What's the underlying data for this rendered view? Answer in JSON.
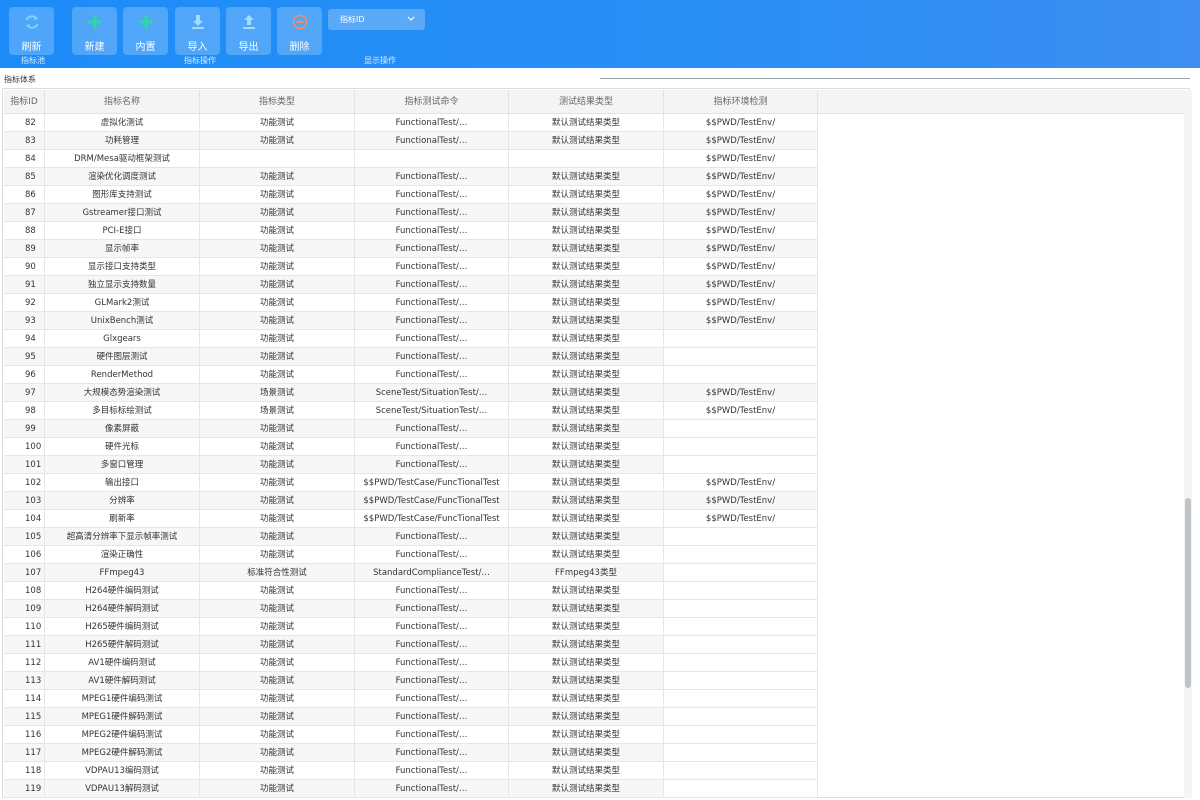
{
  "toolbar": {
    "refresh_label": "刷新",
    "new_label": "新建",
    "builtin_label": "内置",
    "import_label": "导入",
    "export_label": "导出",
    "delete_label": "删除",
    "group_pool": "指标池",
    "group_ops": "指标操作",
    "group_display": "显示操作",
    "dropdown_value": "指标ID"
  },
  "panel": {
    "title": "指标体系"
  },
  "table": {
    "columns": [
      "指标ID",
      "指标名称",
      "指标类型",
      "指标测试命令",
      "测试结果类型",
      "指标环境检测"
    ],
    "rows": [
      [
        "82",
        "虚拟化测试",
        "功能测试",
        "FunctionalTest/…",
        "默认测试结果类型",
        "$$PWD/TestEnv/"
      ],
      [
        "83",
        "功耗管理",
        "功能测试",
        "FunctionalTest/…",
        "默认测试结果类型",
        "$$PWD/TestEnv/"
      ],
      [
        "84",
        "DRM/Mesa驱动框架测试",
        "",
        "",
        "",
        "$$PWD/TestEnv/"
      ],
      [
        "85",
        "渲染优化调度测试",
        "功能测试",
        "FunctionalTest/…",
        "默认测试结果类型",
        "$$PWD/TestEnv/"
      ],
      [
        "86",
        "图形库支持测试",
        "功能测试",
        "FunctionalTest/…",
        "默认测试结果类型",
        "$$PWD/TestEnv/"
      ],
      [
        "87",
        "Gstreamer接口测试",
        "功能测试",
        "FunctionalTest/…",
        "默认测试结果类型",
        "$$PWD/TestEnv/"
      ],
      [
        "88",
        "PCI-E接口",
        "功能测试",
        "FunctionalTest/…",
        "默认测试结果类型",
        "$$PWD/TestEnv/"
      ],
      [
        "89",
        "显示帧率",
        "功能测试",
        "FunctionalTest/…",
        "默认测试结果类型",
        "$$PWD/TestEnv/"
      ],
      [
        "90",
        "显示接口支持类型",
        "功能测试",
        "FunctionalTest/…",
        "默认测试结果类型",
        "$$PWD/TestEnv/"
      ],
      [
        "91",
        "独立显示支持数量",
        "功能测试",
        "FunctionalTest/…",
        "默认测试结果类型",
        "$$PWD/TestEnv/"
      ],
      [
        "92",
        "GLMark2测试",
        "功能测试",
        "FunctionalTest/…",
        "默认测试结果类型",
        "$$PWD/TestEnv/"
      ],
      [
        "93",
        "UnixBench测试",
        "功能测试",
        "FunctionalTest/…",
        "默认测试结果类型",
        "$$PWD/TestEnv/"
      ],
      [
        "94",
        "Glxgears",
        "功能测试",
        "FunctionalTest/…",
        "默认测试结果类型",
        ""
      ],
      [
        "95",
        "硬件图层测试",
        "功能测试",
        "FunctionalTest/…",
        "默认测试结果类型",
        ""
      ],
      [
        "96",
        "RenderMethod",
        "功能测试",
        "FunctionalTest/…",
        "默认测试结果类型",
        ""
      ],
      [
        "97",
        "大规模态势渲染测试",
        "场景测试",
        "SceneTest/SituationTest/…",
        "默认测试结果类型",
        "$$PWD/TestEnv/"
      ],
      [
        "98",
        "多目标标绘测试",
        "场景测试",
        "SceneTest/SituationTest/…",
        "默认测试结果类型",
        "$$PWD/TestEnv/"
      ],
      [
        "99",
        "像素屏蔽",
        "功能测试",
        "FunctionalTest/…",
        "默认测试结果类型",
        ""
      ],
      [
        "100",
        "硬件光标",
        "功能测试",
        "FunctionalTest/…",
        "默认测试结果类型",
        ""
      ],
      [
        "101",
        "多窗口管理",
        "功能测试",
        "FunctionalTest/…",
        "默认测试结果类型",
        ""
      ],
      [
        "102",
        "输出接口",
        "功能测试",
        "$$PWD/TestCase/FuncTionalTest",
        "默认测试结果类型",
        "$$PWD/TestEnv/"
      ],
      [
        "103",
        "分辨率",
        "功能测试",
        "$$PWD/TestCase/FuncTionalTest",
        "默认测试结果类型",
        "$$PWD/TestEnv/"
      ],
      [
        "104",
        "刷新率",
        "功能测试",
        "$$PWD/TestCase/FuncTionalTest",
        "默认测试结果类型",
        "$$PWD/TestEnv/"
      ],
      [
        "105",
        "超高清分辨率下显示帧率测试",
        "功能测试",
        "FunctionalTest/…",
        "默认测试结果类型",
        ""
      ],
      [
        "106",
        "渲染正确性",
        "功能测试",
        "FunctionalTest/…",
        "默认测试结果类型",
        ""
      ],
      [
        "107",
        "FFmpeg43",
        "标准符合性测试",
        "StandardComplianceTest/…",
        "FFmpeg43类型",
        ""
      ],
      [
        "108",
        "H264硬件编码测试",
        "功能测试",
        "FunctionalTest/…",
        "默认测试结果类型",
        ""
      ],
      [
        "109",
        "H264硬件解码测试",
        "功能测试",
        "FunctionalTest/…",
        "默认测试结果类型",
        ""
      ],
      [
        "110",
        "H265硬件编码测试",
        "功能测试",
        "FunctionalTest/…",
        "默认测试结果类型",
        ""
      ],
      [
        "111",
        "H265硬件解码测试",
        "功能测试",
        "FunctionalTest/…",
        "默认测试结果类型",
        ""
      ],
      [
        "112",
        "AV1硬件编码测试",
        "功能测试",
        "FunctionalTest/…",
        "默认测试结果类型",
        ""
      ],
      [
        "113",
        "AV1硬件解码测试",
        "功能测试",
        "FunctionalTest/…",
        "默认测试结果类型",
        ""
      ],
      [
        "114",
        "MPEG1硬件编码测试",
        "功能测试",
        "FunctionalTest/…",
        "默认测试结果类型",
        ""
      ],
      [
        "115",
        "MPEG1硬件解码测试",
        "功能测试",
        "FunctionalTest/…",
        "默认测试结果类型",
        ""
      ],
      [
        "116",
        "MPEG2硬件编码测试",
        "功能测试",
        "FunctionalTest/…",
        "默认测试结果类型",
        ""
      ],
      [
        "117",
        "MPEG2硬件解码测试",
        "功能测试",
        "FunctionalTest/…",
        "默认测试结果类型",
        ""
      ],
      [
        "118",
        "VDPAU13编码测试",
        "功能测试",
        "FunctionalTest/…",
        "默认测试结果类型",
        ""
      ],
      [
        "119",
        "VDPAU13解码测试",
        "功能测试",
        "FunctionalTest/…",
        "默认测试结果类型",
        ""
      ]
    ]
  },
  "colors": {
    "toolbar": "#2a8ff5",
    "accent_green": "#2ed8a0",
    "accent_red": "#ff6a4a"
  },
  "icons": {
    "refresh": "refresh-icon",
    "new": "plus-icon",
    "builtin": "plus-icon",
    "import": "download-icon",
    "export": "upload-icon",
    "delete": "minus-circle-icon",
    "dropdown": "chevron-down-icon"
  }
}
